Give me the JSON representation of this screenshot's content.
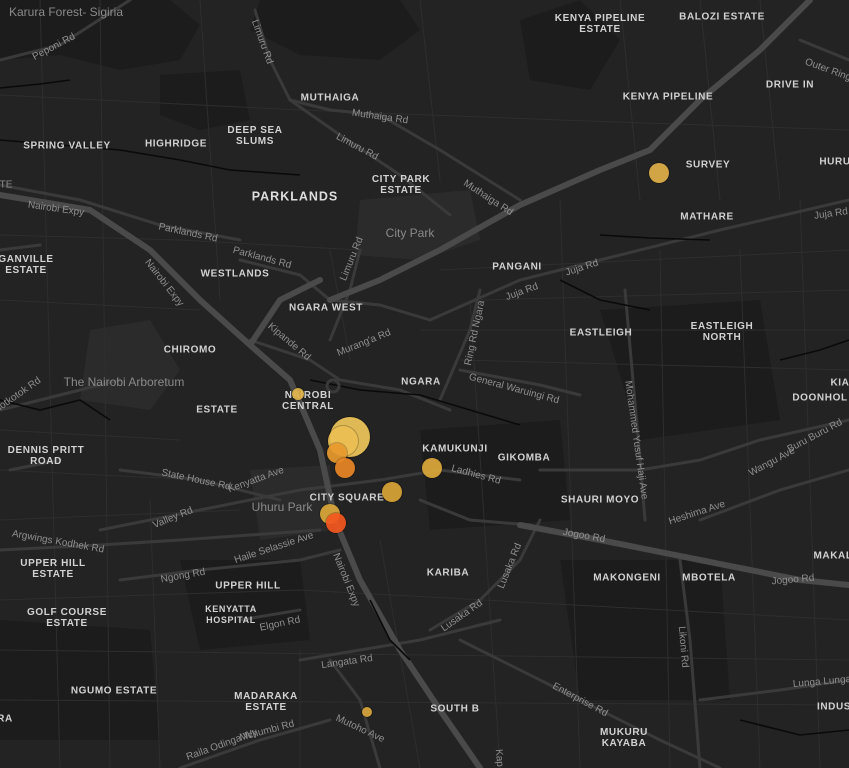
{
  "map": {
    "colors": {
      "land": "#232323",
      "block": "#1c1c1c",
      "park": "#2b2b2b",
      "minor_road": "#2e2e2e",
      "arterial": "#3a3a3a",
      "highway": "#4a4a4a",
      "river": "#0a0a0a"
    },
    "areas": [
      "Karura Forest- Sigiria",
      "BALOZI ESTATE",
      "KENYA PIPELINE ESTATE",
      "MUTHAIGA",
      "KENYA PIPELINE",
      "DRIVE IN",
      "DEEP SEA SLUMS",
      "HIGHRIDGE",
      "SPRING VALLEY",
      "SURVEY",
      "HURU",
      "CITY PARK ESTATE",
      "PARKLANDS",
      "MATHARE",
      "GANVILLE ESTATE",
      "WESTLANDS",
      "PANGANI",
      "NGARA WEST",
      "EASTLEIGH",
      "EASTLEIGH NORTH",
      "CHIROMO",
      "NGARA",
      "KIA",
      "DOONHOL",
      "ESTATE",
      "NAIROBI CENTRAL",
      "DENNIS PRITT ROAD",
      "KAMUKUNJI",
      "GIKOMBA",
      "CITY SQUARE",
      "SHAURI MOYO",
      "UPPER HILL ESTATE",
      "MAKAL",
      "KARIBA",
      "MAKONGENI",
      "MBOTELA",
      "UPPER HILL",
      "GOLF COURSE ESTATE",
      "KENYATTA HOSPITAL",
      "NGUMO ESTATE",
      "MADARAKA ESTATE",
      "SOUTH B",
      "INDUS",
      "RA",
      "MUKURU KAYABA"
    ],
    "roads": [
      "Peponi Rd",
      "Limuru Rd",
      "Outer Ring",
      "Muthaiga Rd",
      "Limuru Rd",
      "Muthaiga Rd",
      "TE",
      "Nairobi Expy",
      "Parklands Rd",
      "Parklands Rd",
      "Limuru Rd",
      "Juja Rd",
      "Juja Rd",
      "Juja Rd",
      "Nairobi Expy",
      "Kipande Rd",
      "Murang'a Rd",
      "Ring Rd Ngara",
      "General Waruingi Rd",
      "Mohammed Yusuf Haji Ave",
      "Wangu Ave",
      "Buru Buru Rd",
      "hotkotok Rd",
      "State House Rd",
      "Kenyatta Ave",
      "Ladhies Rd",
      "Valley Rd",
      "Argwings Kodhek Rd",
      "Haile Selassie Ave",
      "Jogoo Rd",
      "Heshima Ave",
      "Jogoo Rd",
      "Ngong Rd",
      "Lusaka Rd",
      "Nairobi Expy",
      "Lusaka Rd",
      "Elgon Rd",
      "Likoni Rd",
      "Langata Rd",
      "Enterprise Rd",
      "Lunga Lunga",
      "Mchumbi Rd",
      "Raila Odinga Wy",
      "Mutoho Ave",
      "Kap"
    ],
    "parks": [
      "City Park",
      "The Nairobi Arboretum",
      "Uhuru Park"
    ],
    "markers": [
      {
        "color": "#e0b048",
        "value": 4
      },
      {
        "color": "#e0b34a",
        "value": 3
      },
      {
        "color": "#f0c65a",
        "value": 14
      },
      {
        "color": "#ecbf52",
        "value": 10
      },
      {
        "color": "#e89a2e",
        "value": 6
      },
      {
        "color": "#e98625",
        "value": 6
      },
      {
        "color": "#dcaa3a",
        "value": 6
      },
      {
        "color": "#d9a636",
        "value": 6
      },
      {
        "color": "#dba73a",
        "value": 6
      },
      {
        "color": "#f3561e",
        "value": 6
      },
      {
        "color": "#d9a63a",
        "value": 3
      }
    ]
  }
}
